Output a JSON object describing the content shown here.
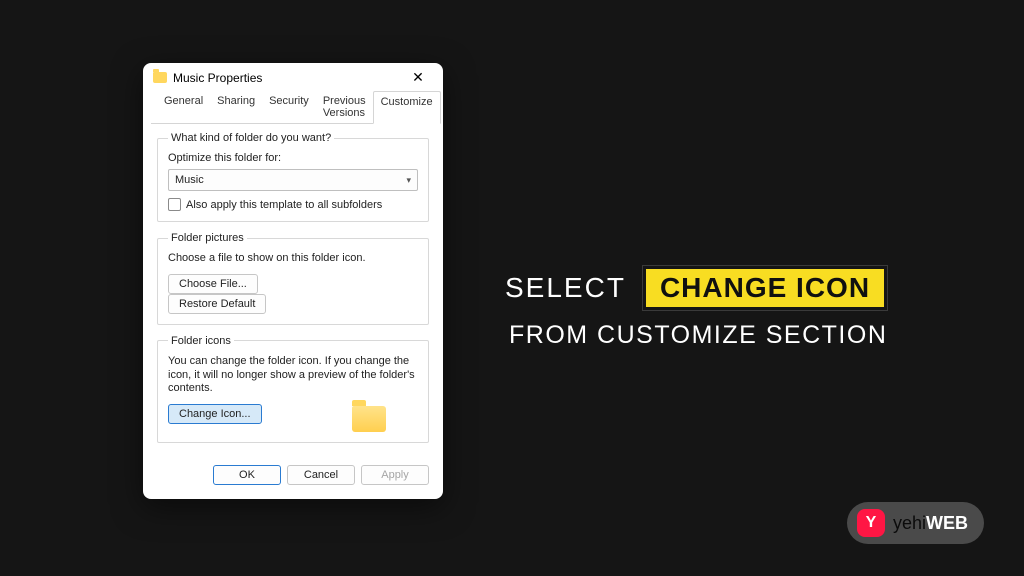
{
  "dialog": {
    "title": "Music Properties",
    "tabs": {
      "general": "General",
      "sharing": "Sharing",
      "security": "Security",
      "previous": "Previous Versions",
      "customize": "Customize"
    },
    "group_kind": {
      "legend": "What kind of folder do you want?",
      "optimize_label": "Optimize this folder for:",
      "combo_value": "Music",
      "subfolders_label": "Also apply this template to all subfolders"
    },
    "group_pictures": {
      "legend": "Folder pictures",
      "desc": "Choose a file to show on this folder icon.",
      "choose_btn": "Choose File...",
      "restore_btn": "Restore Default"
    },
    "group_icons": {
      "legend": "Folder icons",
      "desc": "You can change the folder icon. If you change the icon, it will no longer show a preview of the folder's contents.",
      "change_btn": "Change Icon..."
    },
    "buttons": {
      "ok": "OK",
      "cancel": "Cancel",
      "apply": "Apply"
    }
  },
  "instruction": {
    "select": "SELECT",
    "highlight": "CHANGE ICON",
    "from": "FROM CUSTOMIZE SECTION"
  },
  "brand": {
    "badge": "Y",
    "yehi": "yehi",
    "web": "WEB"
  }
}
